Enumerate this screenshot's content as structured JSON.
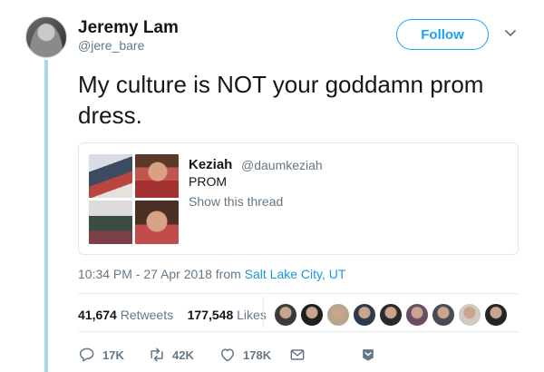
{
  "author": {
    "name": "Jeremy Lam",
    "handle": "@jere_bare"
  },
  "follow_label": "Follow",
  "tweet_text": "My culture is NOT your goddamn prom dress.",
  "quoted_tweet": {
    "name": "Keziah",
    "handle": "@daumkeziah",
    "text": "PROM",
    "show_thread": "Show this thread"
  },
  "meta": {
    "timestamp": "10:34 PM - 27 Apr 2018 from",
    "location": "Salt Lake City, UT"
  },
  "stats": {
    "retweets_count": "41,674",
    "retweets_label": "Retweets",
    "likes_count": "177,548",
    "likes_label": "Likes"
  },
  "liker_avatar_colors": [
    "#3b3b3b",
    "#1f1f1f",
    "#b9a48e",
    "#2d3b4d",
    "#2a2a2a",
    "#6b4e63",
    "#4b4b55",
    "#cfcac3",
    "#242424"
  ],
  "actions": {
    "reply_count": "17K",
    "retweet_count": "42K",
    "like_count": "178K"
  },
  "colors": {
    "accent": "#1da1f2",
    "thread_line": "#a8d8ef",
    "muted": "#657786"
  },
  "icons": [
    "chevron-down-icon",
    "reply-icon",
    "retweet-icon",
    "like-icon",
    "message-icon",
    "bookmark-icon"
  ]
}
